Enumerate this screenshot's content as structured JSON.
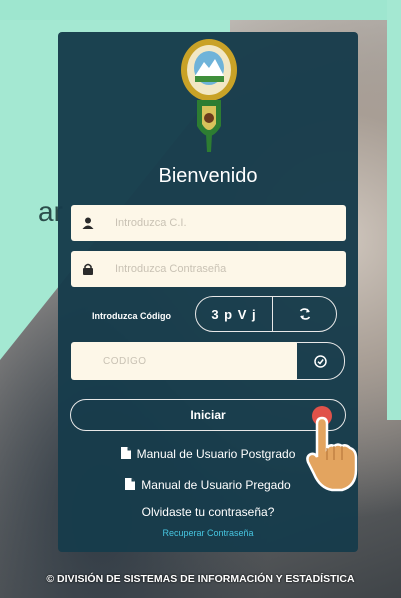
{
  "background": {
    "side_text": "ar"
  },
  "login": {
    "welcome": "Bienvenido",
    "ci_placeholder": "Introduzca C.I.",
    "password_placeholder": "Introduzca Contraseña",
    "captcha_label": "Introduzca Código",
    "captcha_code": "3 p V j",
    "codigo_placeholder": "CODIGO",
    "submit_label": "Iniciar"
  },
  "links": {
    "manual_postgrado": "Manual de Usuario Postgrado",
    "manual_pregrado": "Manual de Usuario Pregado",
    "forgot": "Olvidaste tu contraseña?",
    "recover": "Recuperar Contraseña"
  },
  "footer": {
    "text": "© DIVISIÓN DE SISTEMAS DE INFORMACIÓN Y ESTADÍSTICA"
  },
  "icons": {
    "user": "user-icon",
    "lock": "lock-icon",
    "refresh": "refresh-icon",
    "check": "check-circle-icon",
    "document": "document-icon",
    "pointer": "hand-pointer-icon"
  },
  "colors": {
    "panel": "#173c4b",
    "mint": "#a4e8d2",
    "input_bg": "#fdf7e8",
    "link": "#46c5e0",
    "pointer_dot": "#e0524a"
  }
}
